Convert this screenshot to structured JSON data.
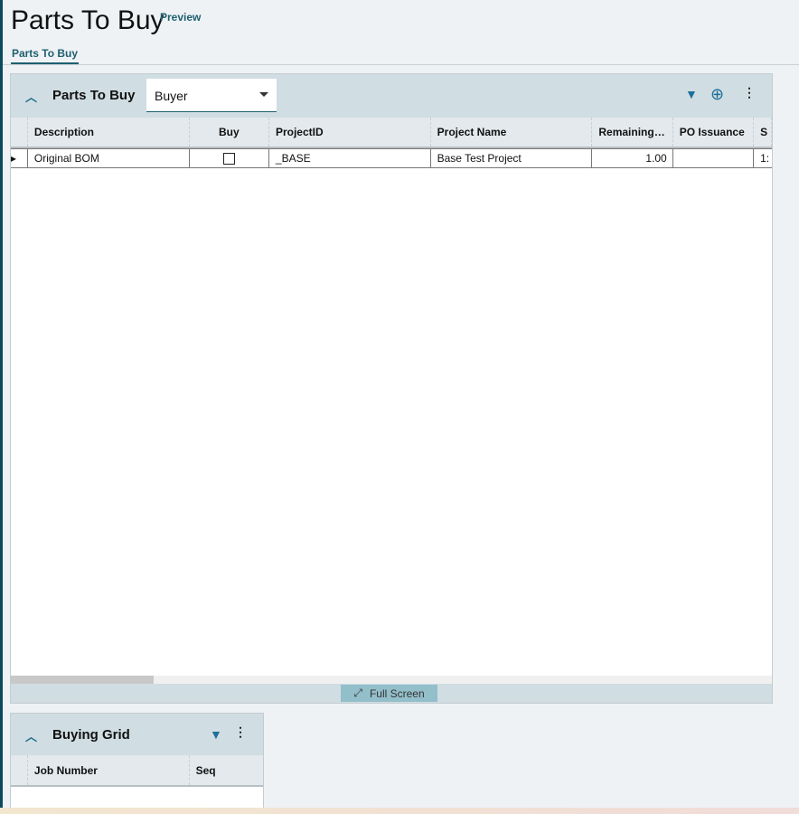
{
  "page": {
    "title": "Parts To Buy",
    "preview": "Preview",
    "tab": "Parts To Buy"
  },
  "panel1": {
    "title": "Parts To Buy",
    "dropdown": "Buyer",
    "columns": [
      "Description",
      "Buy",
      "ProjectID",
      "Project Name",
      "Remaining…",
      "PO Issuance",
      "S"
    ],
    "rows": [
      {
        "description": "Original BOM",
        "buy": false,
        "project_id": "_BASE",
        "project_name": "Base Test Project",
        "remaining": "1.00",
        "po_issuance": "",
        "s": "1:"
      }
    ],
    "full_screen": "Full Screen"
  },
  "panel2": {
    "title": "Buying Grid",
    "columns": [
      "Job Number",
      "Seq"
    ]
  }
}
